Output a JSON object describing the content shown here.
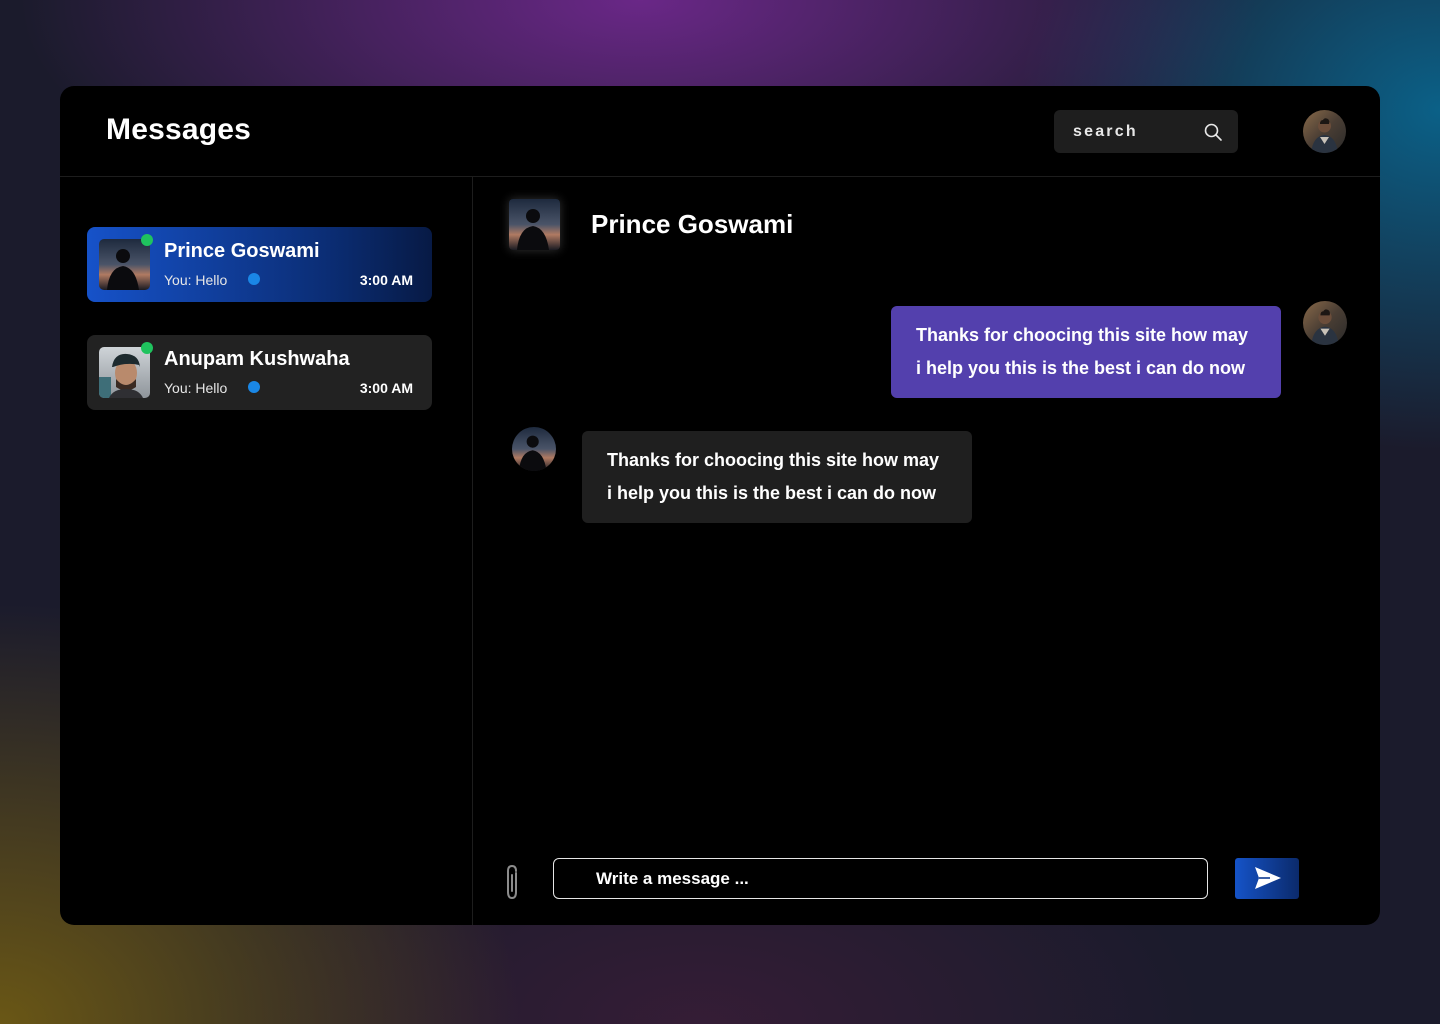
{
  "app": {
    "title": "Messages"
  },
  "search": {
    "placeholder": "search"
  },
  "conversations": [
    {
      "name": "Prince Goswami",
      "preview": "You:  Hello",
      "time": "3:00 AM",
      "active": true,
      "online": true,
      "unread": true
    },
    {
      "name": "Anupam Kushwaha",
      "preview": "You:  Hello",
      "time": "3:00 AM",
      "active": false,
      "online": true,
      "unread": true
    }
  ],
  "chat": {
    "contact_name": "Prince Goswami",
    "messages": [
      {
        "direction": "outgoing",
        "text": "Thanks for choocing this site how may\ni help you  this is the best i can do now"
      },
      {
        "direction": "incoming",
        "text": "Thanks for choocing this site how may\ni help you  this is the best i can do now"
      }
    ],
    "composer_placeholder": "Write a message ..."
  },
  "colors": {
    "outgoing_bubble": "#5340ad",
    "incoming_bubble": "#1f1f1f",
    "online_dot": "#1fc35e",
    "unread_dot": "#1a87e6",
    "accent_blue": "#1553c8"
  },
  "icons": [
    "search-icon",
    "paperclip-icon",
    "send-icon"
  ]
}
